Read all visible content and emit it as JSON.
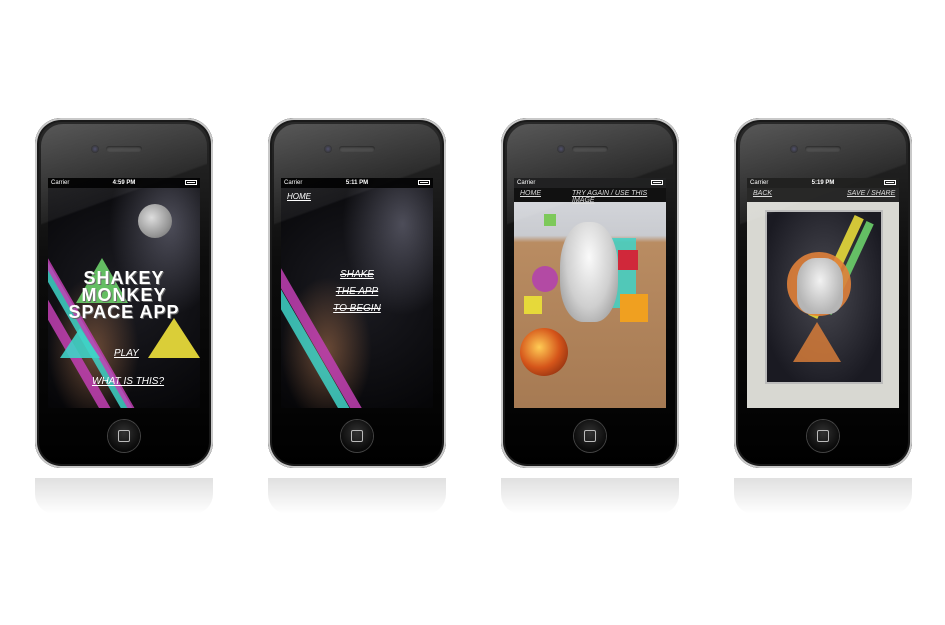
{
  "phones": [
    {
      "status": {
        "carrier": "Carrier",
        "time": "4:59 PM"
      },
      "title_lines": [
        "SHAKEY",
        "MONKEY",
        "SPACE APP"
      ],
      "play_label": "PLAY",
      "what_label": "WHAT IS THIS?"
    },
    {
      "status": {
        "carrier": "Carrier",
        "time": "5:11 PM"
      },
      "home_label": "HOME",
      "shake_lines": [
        "SHAKE",
        "THE APP",
        "TO BEGIN"
      ]
    },
    {
      "status": {
        "carrier": "Carrier",
        "time": ""
      },
      "home_label": "HOME",
      "action_label": "TRY AGAIN / USE THIS IMAGE"
    },
    {
      "status": {
        "carrier": "Carrier",
        "time": "5:19 PM"
      },
      "back_label": "BACK",
      "save_label": "SAVE / SHARE"
    }
  ],
  "colors": {
    "cyan": "#3fd3c8",
    "magenta": "#c23fb4",
    "yellow": "#e6d93a",
    "green": "#6ccf6a"
  },
  "icons": [
    "wifi-icon",
    "battery-icon",
    "home-button-icon",
    "owl-image",
    "skull-image",
    "moon-image"
  ]
}
